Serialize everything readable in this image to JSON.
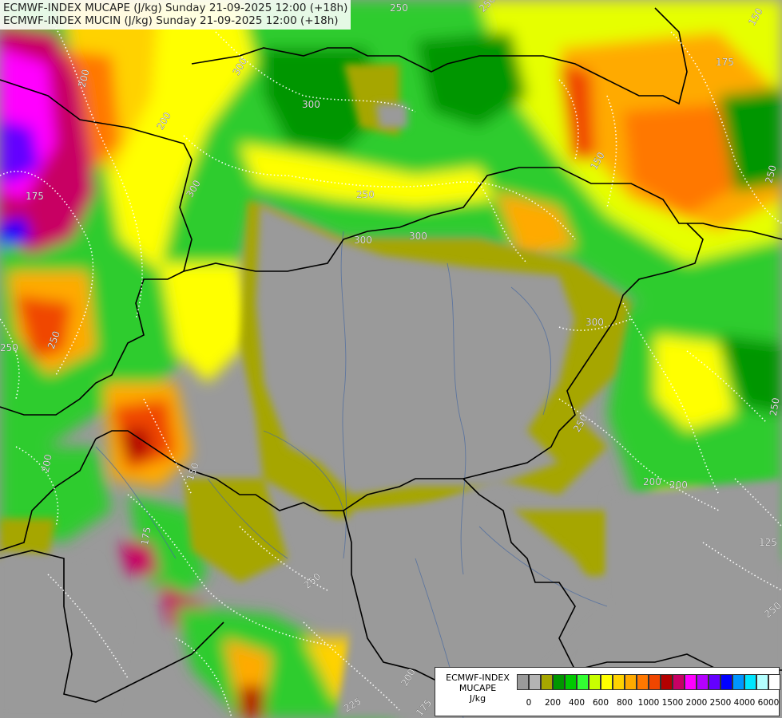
{
  "header": {
    "line1": "ECMWF-INDEX MUCAPE (J/kg) Sunday 21-09-2025 12:00 (+18h)",
    "line2": "ECMWF-INDEX MUCIN (J/kg) Sunday 21-09-2025 12:00 (+18h)"
  },
  "legend": {
    "title1": "ECMWF-INDEX",
    "title2": "MUCAPE",
    "unit": "J/kg",
    "colors": [
      "#9a9a9a",
      "#b4b4b4",
      "#a6a600",
      "#009600",
      "#00c800",
      "#32ff32",
      "#c8ff00",
      "#ffff00",
      "#ffd200",
      "#ffaa00",
      "#ff7800",
      "#f04600",
      "#b40000",
      "#c80064",
      "#ff00ff",
      "#b400ff",
      "#6400ff",
      "#0000ff",
      "#0096ff",
      "#00e6ff",
      "#b4ffff",
      "#ffffff"
    ],
    "ticks": [
      "0",
      "200",
      "400",
      "600",
      "800",
      "1000",
      "1500",
      "2000",
      "2500",
      "4000",
      "6000"
    ]
  },
  "map": {
    "mucin_contour_labels": [
      "250",
      "300",
      "300",
      "250",
      "300",
      "300",
      "300",
      "250",
      "250",
      "250",
      "200",
      "175",
      "150",
      "125",
      "250",
      "175",
      "200",
      "250",
      "200",
      "250",
      "225",
      "200",
      "175",
      "150",
      "175",
      "200",
      "250",
      "300",
      "200",
      "150",
      "250"
    ]
  }
}
